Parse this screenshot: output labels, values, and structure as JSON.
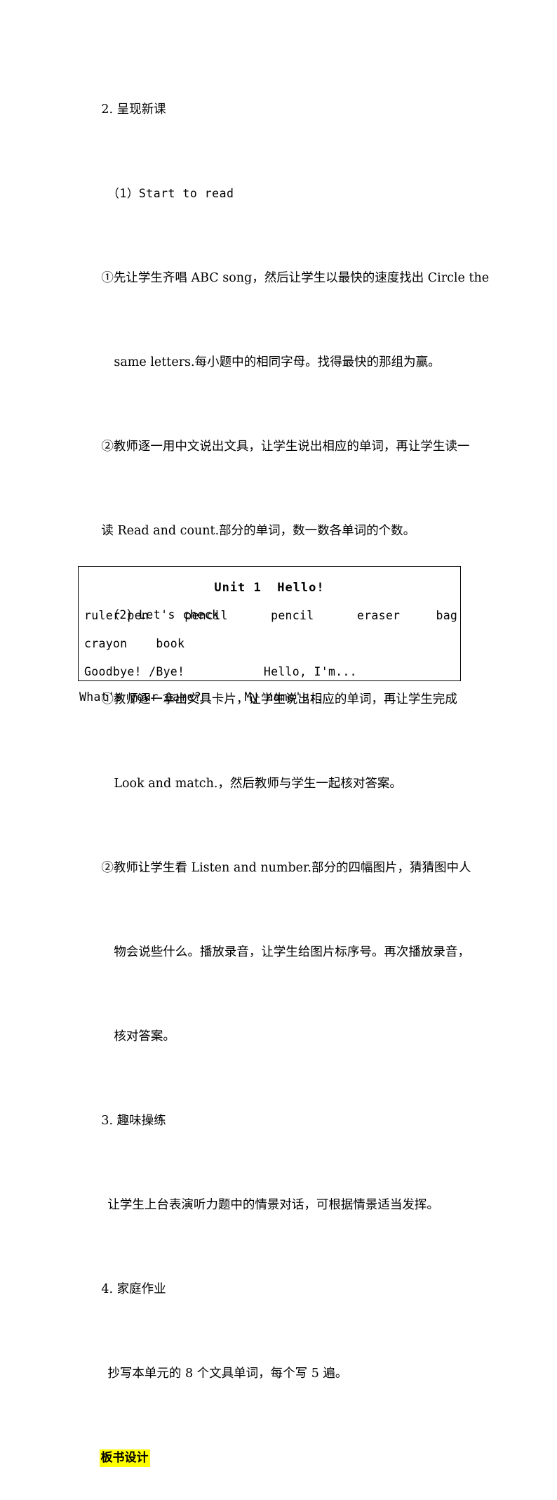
{
  "document": {
    "colors": {
      "text": "#000000",
      "highlight": "#ffff00",
      "box_border": "#000000",
      "page_background": "#ffffff"
    },
    "body_lines": [
      {
        "id": "sec-2-heading",
        "text": "2. 呈现新课"
      },
      {
        "id": "sub-1-heading",
        "text": "（1）Start to read"
      },
      {
        "id": "item-1-1-line-1",
        "text": "①先让学生齐唱 ABC song，然后让学生以最快的速度找出 Circle the"
      },
      {
        "id": "item-1-1-line-2",
        "text": "same letters.每小题中的相同字母。找得最快的那组为赢。"
      },
      {
        "id": "item-1-2-line-1",
        "text": "②教师逐一用中文说出文具，让学生说出相应的单词，再让学生读一"
      },
      {
        "id": "item-1-2-line-2",
        "text": "读 Read and count.部分的单词，数一数各单词的个数。"
      },
      {
        "id": "sub-2-heading",
        "text": "（2）Let's check"
      },
      {
        "id": "item-2-1-line-1",
        "text": "①教师逐一拿出文具卡片，让学生说出相应的单词，再让学生完成"
      },
      {
        "id": "item-2-1-line-2",
        "text": "Look and match.，然后教师与学生一起核对答案。"
      },
      {
        "id": "item-2-2-line-1",
        "text": "②教师让学生看 Listen and number.部分的四幅图片，猜猜图中人"
      },
      {
        "id": "item-2-2-line-2",
        "text": "物会说些什么。播放录音，让学生给图片标序号。再次播放录音，"
      },
      {
        "id": "item-2-2-line-3",
        "text": "核对答案。"
      },
      {
        "id": "sec-3-heading",
        "text": "3. 趣味操练"
      },
      {
        "id": "sec-3-body",
        "text": "让学生上台表演听力题中的情景对话，可根据情景适当发挥。"
      },
      {
        "id": "sec-4-heading",
        "text": "4. 家庭作业"
      },
      {
        "id": "sec-4-body",
        "text": "抄写本单元的 8 个文具单词，每个写 5 遍。"
      }
    ],
    "highlighted_heading": "板书设计",
    "board": {
      "title": "Unit 1  Hello!",
      "lines": [
        "ruler pen     pencil      pencil      eraser     bag",
        "crayon    book",
        "Goodbye! /Bye!           Hello, I'm..."
      ]
    },
    "after_box_line": "What's your name?      My name's..."
  }
}
